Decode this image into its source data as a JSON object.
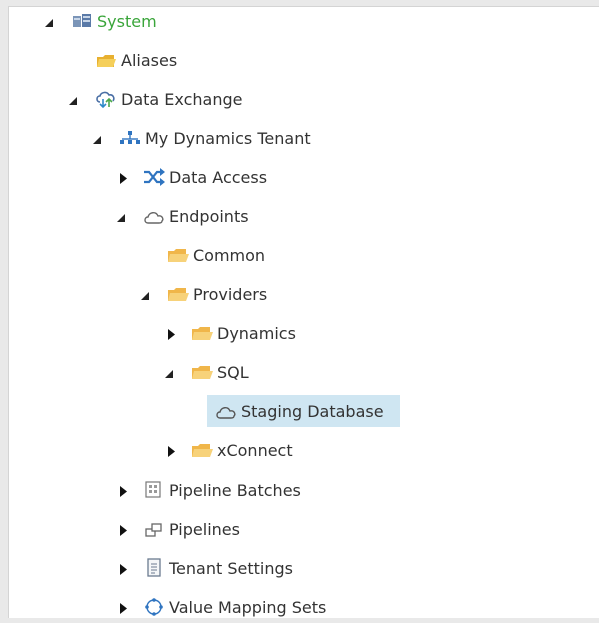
{
  "tree": {
    "system": {
      "label": "System",
      "expanded": true
    },
    "aliases": {
      "label": "Aliases"
    },
    "data_exchange": {
      "label": "Data Exchange",
      "expanded": true
    },
    "tenant": {
      "label": "My Dynamics Tenant",
      "expanded": true
    },
    "data_access": {
      "label": "Data Access",
      "expanded": false
    },
    "endpoints": {
      "label": "Endpoints",
      "expanded": true
    },
    "common": {
      "label": "Common"
    },
    "providers": {
      "label": "Providers",
      "expanded": true
    },
    "dynamics": {
      "label": "Dynamics",
      "expanded": false
    },
    "sql": {
      "label": "SQL",
      "expanded": true
    },
    "staging_database": {
      "label": "Staging Database",
      "selected": true
    },
    "xconnect": {
      "label": "xConnect",
      "expanded": false
    },
    "pipeline_batches": {
      "label": "Pipeline Batches",
      "expanded": false
    },
    "pipelines": {
      "label": "Pipelines",
      "expanded": false
    },
    "tenant_settings": {
      "label": "Tenant Settings",
      "expanded": false
    },
    "value_mapping_sets": {
      "label": "Value Mapping Sets",
      "expanded": false
    }
  },
  "colors": {
    "system_label": "#3aa53a",
    "selection": "#cfe6f2",
    "folder": "#f2c04a",
    "data_access_icon": "#2f74c0"
  }
}
